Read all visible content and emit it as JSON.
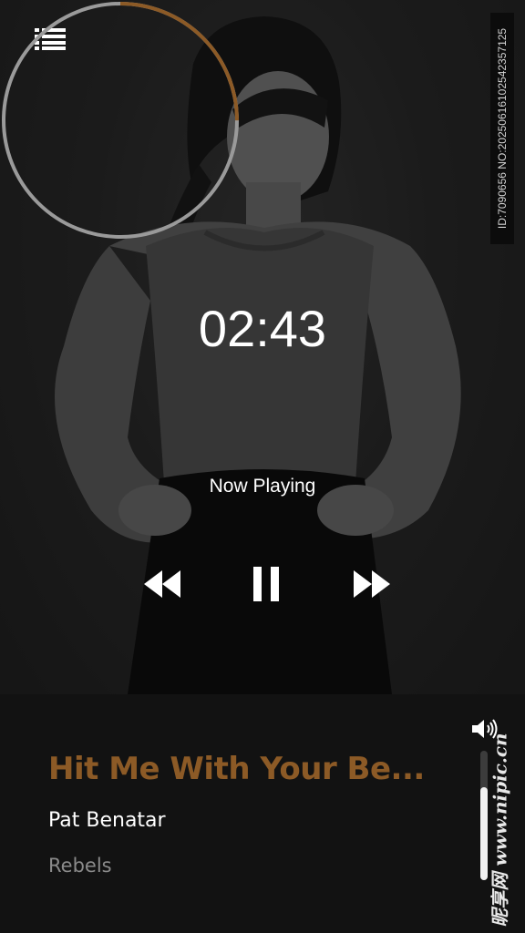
{
  "header": {
    "menu_icon": "list-menu-icon"
  },
  "id_stamp": "ID:7090656 NO:20250616102542357125",
  "player": {
    "elapsed": "02:43",
    "progress_fraction": 0.25,
    "status": "Now Playing",
    "controls": {
      "rewind_icon": "rewind-icon",
      "pause_icon": "pause-icon",
      "forward_icon": "fast-forward-icon"
    }
  },
  "track": {
    "title": "Hit Me With Your Be...",
    "artist": "Pat Benatar",
    "album": "Rebels"
  },
  "volume": {
    "icon": "speaker-icon",
    "level_fraction": 0.72
  },
  "watermark": "昵享网 www.nipic.cn",
  "colors": {
    "accent": "#8c5a26",
    "ring_track": "#9a9a9a",
    "panel_bg": "#121212",
    "text_primary": "#ffffff",
    "text_secondary": "#8a8a8a"
  }
}
